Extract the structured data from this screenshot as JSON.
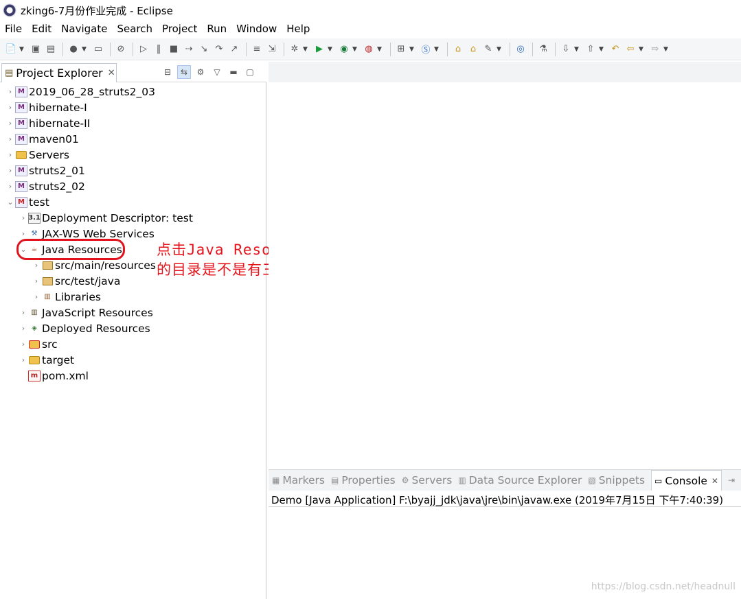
{
  "window": {
    "title": "zking6-7月份作业完成 - Eclipse"
  },
  "menubar": {
    "items": [
      "File",
      "Edit",
      "Navigate",
      "Search",
      "Project",
      "Run",
      "Window",
      "Help"
    ]
  },
  "explorer": {
    "tab_label": "Project Explorer",
    "tree": [
      {
        "label": "2019_06_28_struts2_03",
        "icon": "maven-project-icon",
        "expanded": false,
        "depth": 0
      },
      {
        "label": "hibernate-I",
        "icon": "maven-project-icon",
        "expanded": false,
        "depth": 0
      },
      {
        "label": "hibernate-II",
        "icon": "maven-project-icon",
        "expanded": false,
        "depth": 0
      },
      {
        "label": "maven01",
        "icon": "maven-project-icon",
        "expanded": false,
        "depth": 0
      },
      {
        "label": "Servers",
        "icon": "folder-icon",
        "expanded": false,
        "depth": 0
      },
      {
        "label": "struts2_01",
        "icon": "maven-project-icon",
        "expanded": false,
        "depth": 0
      },
      {
        "label": "struts2_02",
        "icon": "maven-project-icon",
        "expanded": false,
        "depth": 0
      },
      {
        "label": "test",
        "icon": "maven-project-error-icon",
        "expanded": true,
        "depth": 0
      },
      {
        "label": "Deployment Descriptor: test",
        "icon": "web-descriptor-icon",
        "expanded": false,
        "depth": 1
      },
      {
        "label": "JAX-WS Web Services",
        "icon": "web-services-icon",
        "expanded": false,
        "depth": 1
      },
      {
        "label": "Java Resources",
        "icon": "java-resources-icon",
        "expanded": true,
        "depth": 1
      },
      {
        "label": "src/main/resources",
        "icon": "source-folder-icon",
        "expanded": false,
        "depth": 2
      },
      {
        "label": "src/test/java",
        "icon": "source-folder-icon",
        "expanded": false,
        "depth": 2
      },
      {
        "label": "Libraries",
        "icon": "libraries-icon",
        "expanded": false,
        "depth": 2
      },
      {
        "label": "JavaScript Resources",
        "icon": "javascript-resources-icon",
        "expanded": false,
        "depth": 1
      },
      {
        "label": "Deployed Resources",
        "icon": "deployed-resources-icon",
        "expanded": false,
        "depth": 1
      },
      {
        "label": "src",
        "icon": "folder-error-icon",
        "expanded": false,
        "depth": 1
      },
      {
        "label": "target",
        "icon": "folder-icon",
        "expanded": false,
        "depth": 1
      },
      {
        "label": "pom.xml",
        "icon": "xml-file-icon",
        "expanded": null,
        "depth": 1
      }
    ]
  },
  "annotation": {
    "line1": "点击Java Resources,看一看它下面",
    "line2": "的目录是不是有三个。",
    "color": "#e4141c"
  },
  "bottom_panel": {
    "tabs": [
      {
        "label": "Markers",
        "icon": "markers-icon",
        "active": false
      },
      {
        "label": "Properties",
        "icon": "properties-icon",
        "active": false
      },
      {
        "label": "Servers",
        "icon": "servers-icon",
        "active": false
      },
      {
        "label": "Data Source Explorer",
        "icon": "data-source-icon",
        "active": false
      },
      {
        "label": "Snippets",
        "icon": "snippets-icon",
        "active": false
      },
      {
        "label": "Console",
        "icon": "console-icon",
        "active": true
      }
    ],
    "console_text": "Demo [Java Application] F:\\byajj_jdk\\java\\jre\\bin\\javaw.exe (2019年7月15日 下午7:40:39)"
  },
  "watermark": "https://blog.csdn.net/headnull"
}
